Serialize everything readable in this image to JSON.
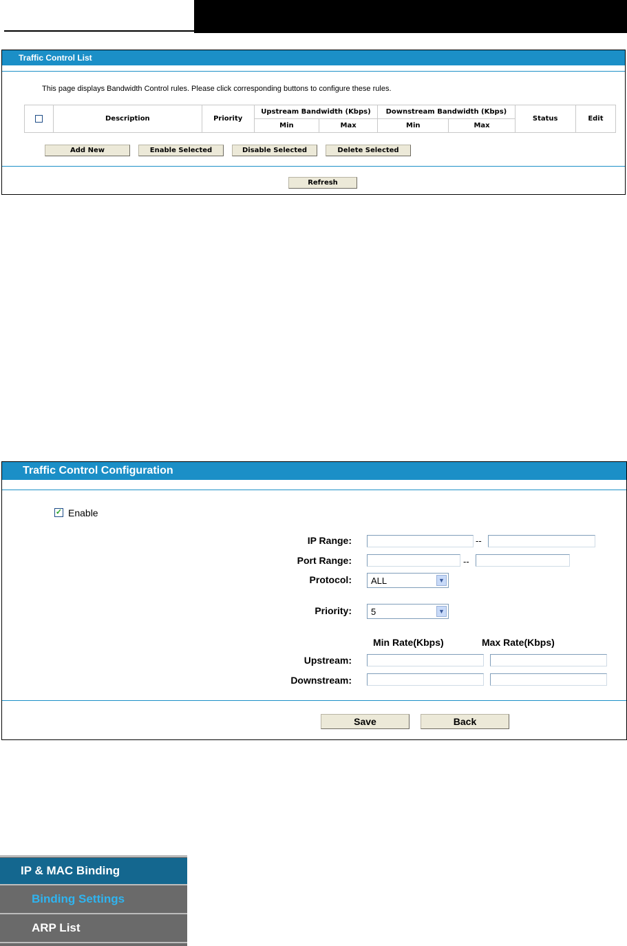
{
  "traffic_control_list": {
    "title": "Traffic Control List",
    "description": "This page displays Bandwidth Control rules. Please click corresponding buttons to configure these rules.",
    "columns": {
      "description": "Description",
      "priority": "Priority",
      "upstream": "Upstream Bandwidth (Kbps)",
      "downstream": "Downstream Bandwidth (Kbps)",
      "status": "Status",
      "edit": "Edit",
      "min": "Min",
      "max": "Max"
    },
    "buttons": {
      "add_new": "Add New",
      "enable_selected": "Enable Selected",
      "disable_selected": "Disable Selected",
      "delete_selected": "Delete Selected",
      "refresh": "Refresh"
    }
  },
  "traffic_control_config": {
    "title": "Traffic Control Configuration",
    "enable_label": "Enable",
    "enable_checked": true,
    "ip_range_label": "IP Range:",
    "port_range_label": "Port Range:",
    "range_separator": "--",
    "protocol_label": "Protocol:",
    "protocol_value": "ALL",
    "priority_label": "Priority:",
    "priority_value": "5",
    "min_rate_header": "Min Rate(Kbps)",
    "max_rate_header": "Max Rate(Kbps)",
    "upstream_label": "Upstream:",
    "downstream_label": "Downstream:",
    "save_label": "Save",
    "back_label": "Back"
  },
  "menu": {
    "section": "IP & MAC Binding",
    "items": [
      "Binding Settings",
      "ARP List"
    ],
    "active_item_color": "#2fb4f0"
  },
  "colors": {
    "title_bar": "#1b8fc7",
    "header_bar": "#000000"
  }
}
